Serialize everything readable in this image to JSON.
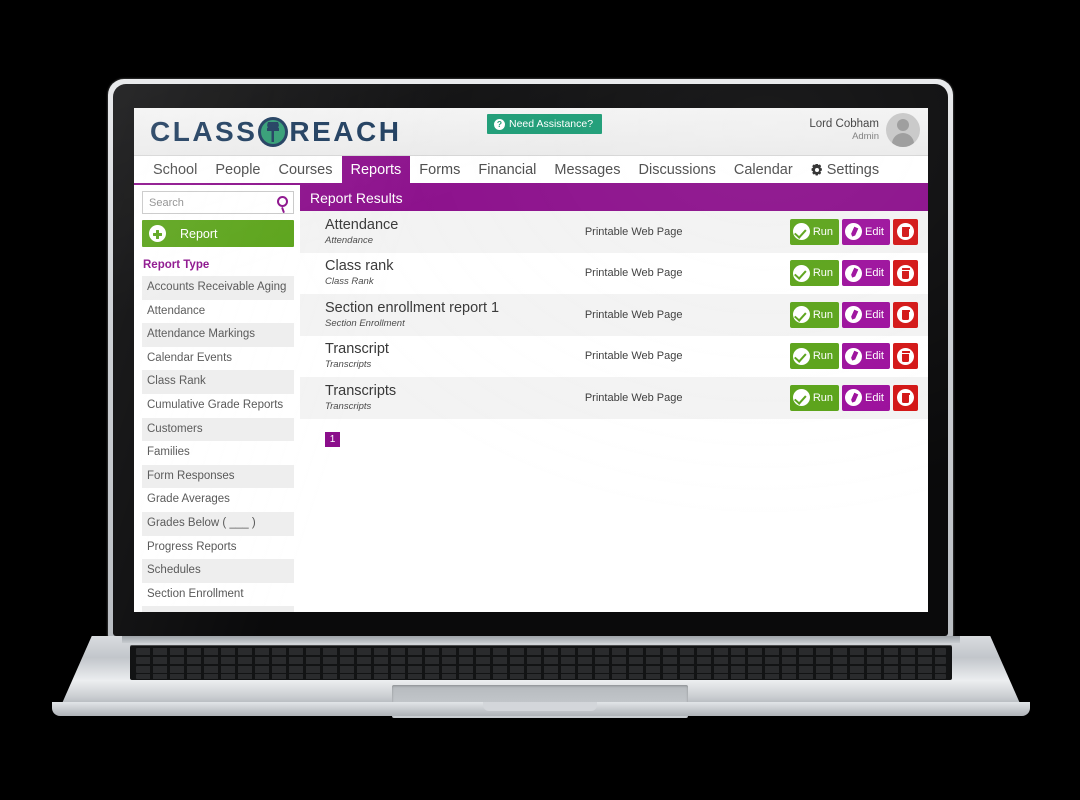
{
  "brand": {
    "name_left": "CLASS",
    "name_right": "REACH",
    "logo_mark": "globe-person-icon",
    "navy": "#1b3a5c",
    "green": "#2e9b72",
    "purple": "#8b0e8b"
  },
  "header": {
    "assistance_button": "Need Assistance?",
    "assistance_icon": "question-mark-circle-icon",
    "user_name": "Lord Cobham",
    "user_role": "Admin",
    "avatar_icon": "user-avatar-icon"
  },
  "nav": {
    "items": [
      {
        "label": "School",
        "active": false
      },
      {
        "label": "People",
        "active": false
      },
      {
        "label": "Courses",
        "active": false
      },
      {
        "label": "Reports",
        "active": true
      },
      {
        "label": "Forms",
        "active": false
      },
      {
        "label": "Financial",
        "active": false
      },
      {
        "label": "Messages",
        "active": false
      },
      {
        "label": "Discussions",
        "active": false
      },
      {
        "label": "Calendar",
        "active": false
      },
      {
        "label": "Settings",
        "active": false,
        "icon": "gear-icon"
      }
    ]
  },
  "sidebar": {
    "search": {
      "value": "",
      "placeholder": "Search",
      "icon": "search-icon"
    },
    "add_button": {
      "label": "Report",
      "icon": "plus-circle-icon"
    },
    "section_title": "Report Type",
    "report_types": [
      "Accounts Receivable Aging",
      "Attendance",
      "Attendance Markings",
      "Calendar Events",
      "Class Rank",
      "Cumulative Grade Reports",
      "Customers",
      "Families",
      "Form Responses",
      "Grade Averages",
      "Grades Below ( ___ )",
      "Progress Reports",
      "Schedules",
      "Section Enrollment"
    ]
  },
  "main": {
    "panel_title": "Report Results",
    "actions": {
      "run": {
        "label": "Run",
        "icon": "check-circle-icon",
        "color": "#5aa318"
      },
      "edit": {
        "label": "Edit",
        "icon": "pencil-circle-icon",
        "color": "#9c0f9c"
      },
      "delete": {
        "label": "",
        "icon": "trash-circle-icon",
        "color": "#d31515"
      }
    },
    "rows": [
      {
        "title": "Attendance",
        "subtitle": "Attendance",
        "format": "Printable Web Page"
      },
      {
        "title": "Class rank",
        "subtitle": "Class Rank",
        "format": "Printable Web Page"
      },
      {
        "title": "Section enrollment report 1",
        "subtitle": "Section Enrollment",
        "format": "Printable Web Page"
      },
      {
        "title": "Transcript",
        "subtitle": "Transcripts",
        "format": "Printable Web Page"
      },
      {
        "title": "Transcripts",
        "subtitle": "Transcripts",
        "format": "Printable Web Page"
      }
    ],
    "pagination": {
      "pages": [
        "1"
      ],
      "current": "1"
    }
  }
}
